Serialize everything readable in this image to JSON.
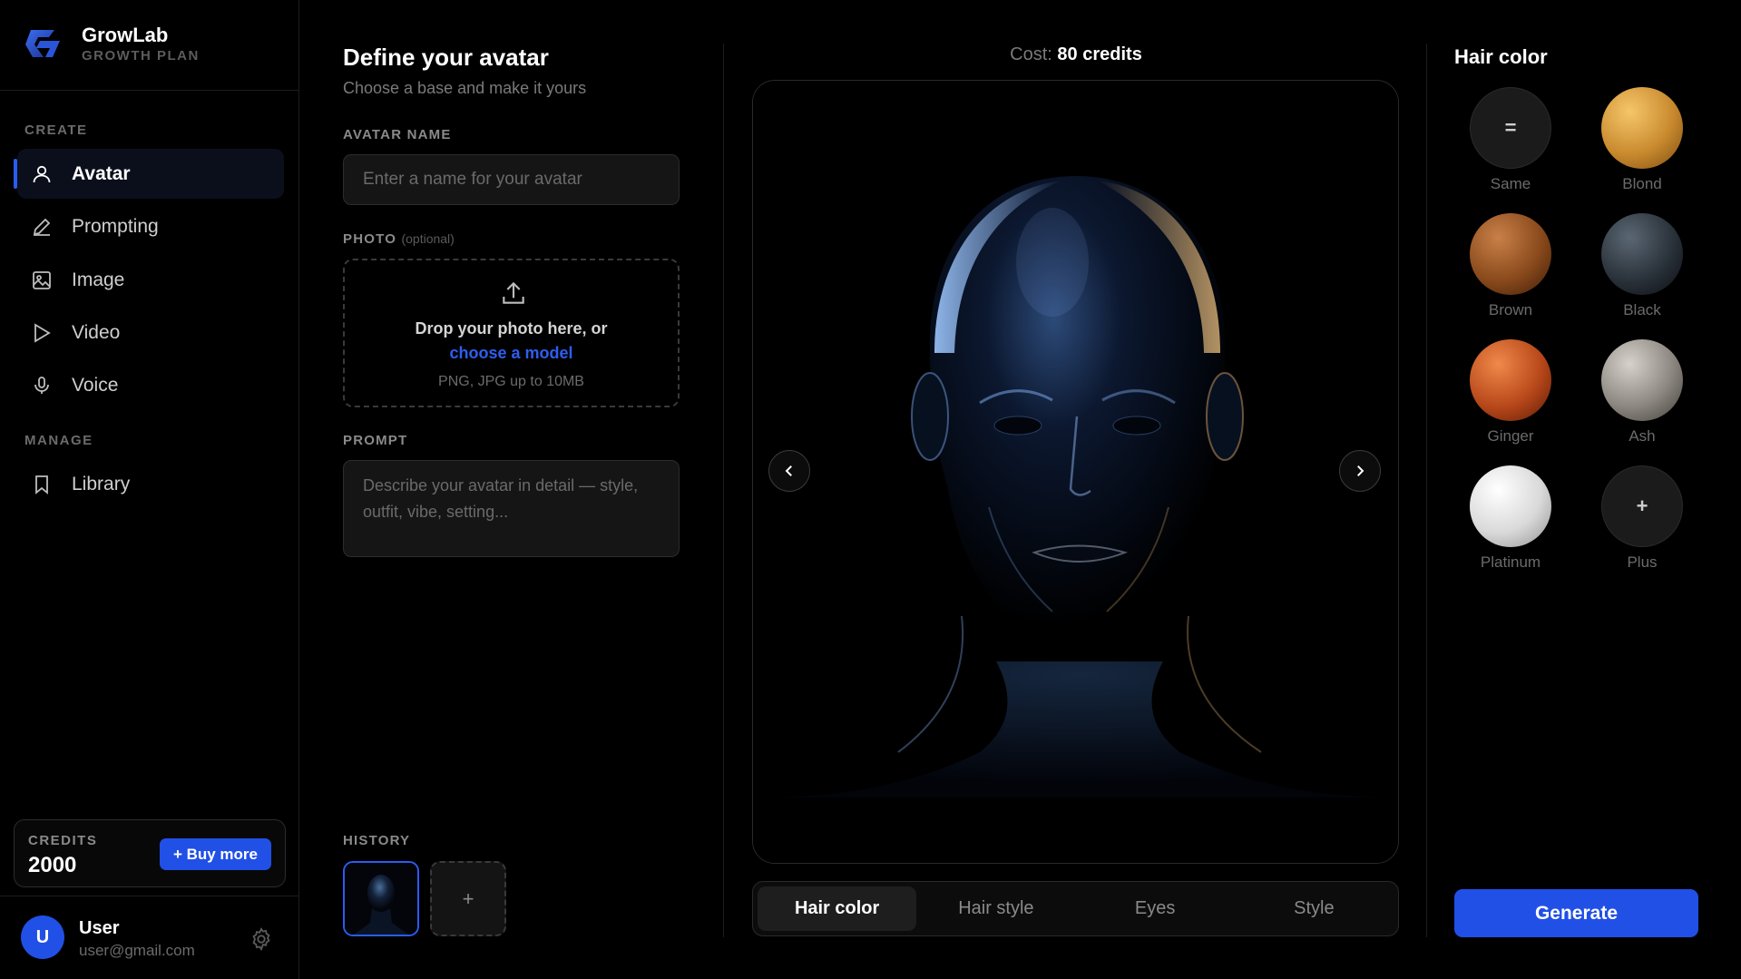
{
  "brand": {
    "name": "GrowLab",
    "plan": "GROWTH PLAN"
  },
  "sidebar": {
    "create_label": "CREATE",
    "manage_label": "MANAGE",
    "items": [
      {
        "label": "Avatar",
        "icon": "user-icon",
        "active": true
      },
      {
        "label": "Prompting",
        "icon": "pencil-icon"
      },
      {
        "label": "Image",
        "icon": "image-icon"
      },
      {
        "label": "Video",
        "icon": "play-icon"
      },
      {
        "label": "Voice",
        "icon": "microphone-icon"
      },
      {
        "label": "Library",
        "icon": "bookmark-icon"
      }
    ],
    "credits": {
      "label": "CREDITS",
      "value": "2000",
      "buy_label": "+ Buy more"
    },
    "user": {
      "initial": "U",
      "name": "User",
      "email": "user@gmail.com"
    }
  },
  "form": {
    "title": "Define your avatar",
    "subtitle": "Choose a base and make it yours",
    "name_label": "AVATAR NAME",
    "name_placeholder": "Enter a name for your avatar",
    "name_value": "",
    "photo_label": "PHOTO",
    "photo_optional": "(optional)",
    "drop_text": "Drop your photo here, or",
    "drop_link": "choose a model",
    "drop_hint": "PNG, JPG up to 10MB",
    "prompt_label": "PROMPT",
    "prompt_placeholder": "Describe your avatar in detail — style, outfit, vibe, setting...",
    "history_label": "HISTORY",
    "history_add": "+"
  },
  "preview": {
    "cost_label": "Cost:",
    "cost_value": "80 credits",
    "tabs": [
      {
        "label": "Hair color",
        "active": true
      },
      {
        "label": "Hair style"
      },
      {
        "label": "Eyes"
      },
      {
        "label": "Style"
      }
    ]
  },
  "hair_panel": {
    "title": "Hair color",
    "options": [
      {
        "name": "Same",
        "glyph": "="
      },
      {
        "name": "Blond",
        "color": "#c98a2e"
      },
      {
        "name": "Brown",
        "color": "#8a4a1c"
      },
      {
        "name": "Black",
        "color": "#2a323a"
      },
      {
        "name": "Ginger",
        "color": "#b8481a"
      },
      {
        "name": "Ash",
        "color": "#8c8780"
      },
      {
        "name": "Platinum",
        "color": "#d9d9d9"
      },
      {
        "name": "Plus",
        "glyph": "+"
      }
    ],
    "generate_label": "Generate"
  },
  "colors": {
    "accent": "#2150e6",
    "background": "#000000"
  }
}
